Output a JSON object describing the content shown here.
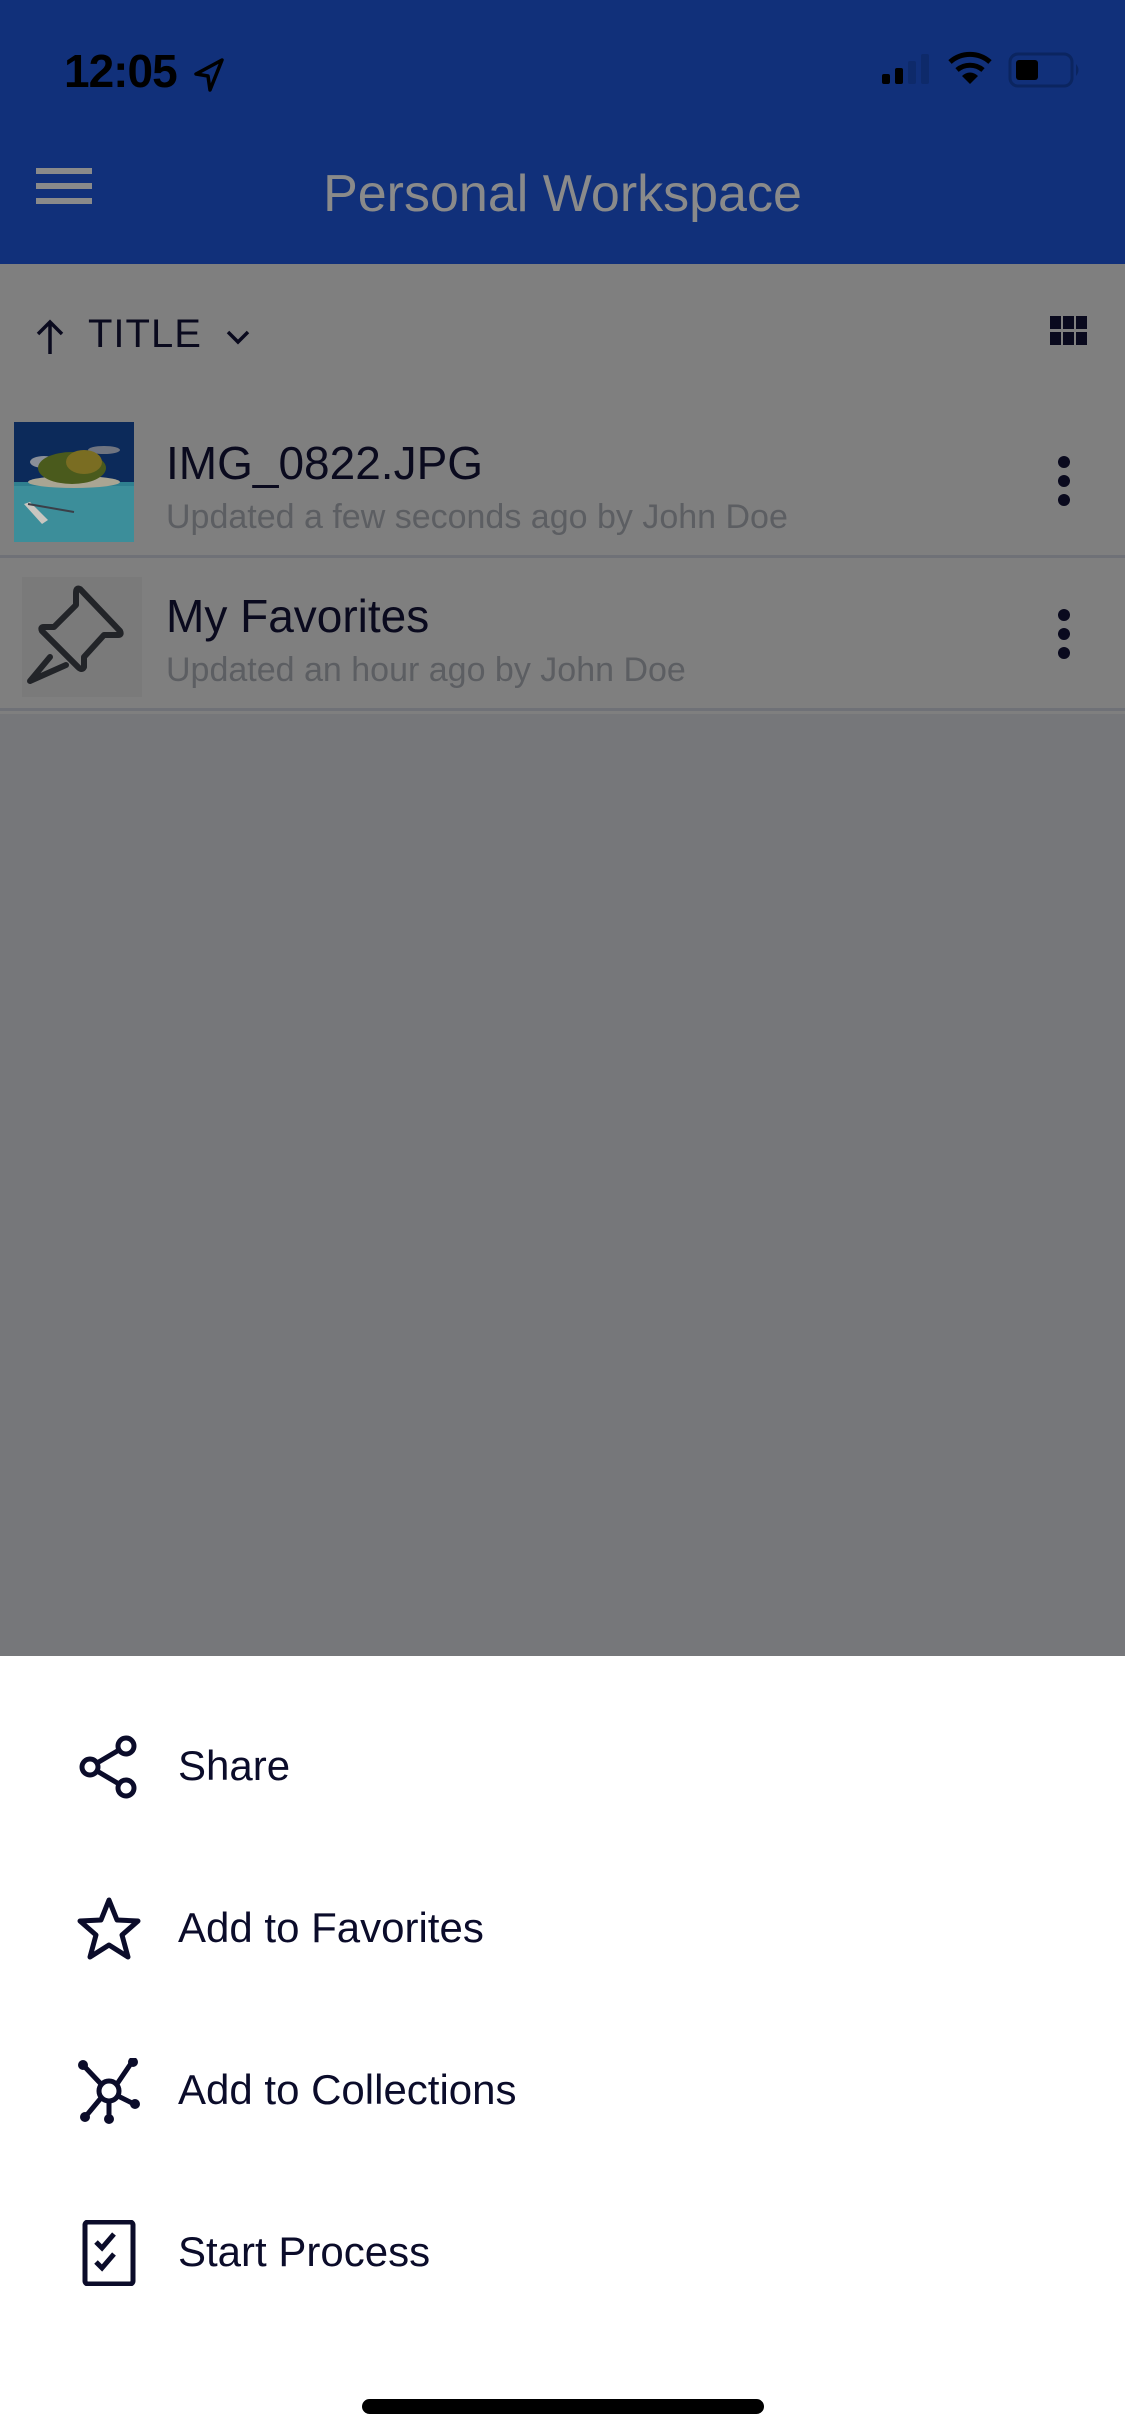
{
  "status_bar": {
    "time": "12:05",
    "icons": [
      "location-arrow-icon",
      "cellular-signal-icon",
      "wifi-icon",
      "battery-icon"
    ]
  },
  "app_bar": {
    "title": "Personal Workspace",
    "menu_icon": "hamburger-menu-icon"
  },
  "sort_bar": {
    "direction_icon": "arrow-up-icon",
    "label": "TITLE",
    "dropdown_icon": "chevron-down-icon",
    "view_toggle_icon": "grid-view-icon"
  },
  "items": [
    {
      "title": "IMG_0822.JPG",
      "subtitle": "Updated a few seconds ago by John Doe",
      "thumbnail": "tropical-island-photo",
      "menu_icon": "more-vertical-icon"
    },
    {
      "title": "My Favorites",
      "subtitle": "Updated an hour ago by John Doe",
      "thumbnail": "pushpin-icon",
      "menu_icon": "more-vertical-icon"
    }
  ],
  "action_sheet": {
    "actions": [
      {
        "label": "Share",
        "icon": "share-icon"
      },
      {
        "label": "Add to Favorites",
        "icon": "star-icon"
      },
      {
        "label": "Add to Collections",
        "icon": "collections-icon"
      },
      {
        "label": "Start Process",
        "icon": "checklist-icon"
      }
    ]
  },
  "colors": {
    "app_bar_dimmed": "#11307a",
    "list_dimmed": "#7f7f7f",
    "overlay_bg": "#76777a",
    "sheet_text": "#0b0c2a",
    "sheet_bg": "#ffffff"
  }
}
